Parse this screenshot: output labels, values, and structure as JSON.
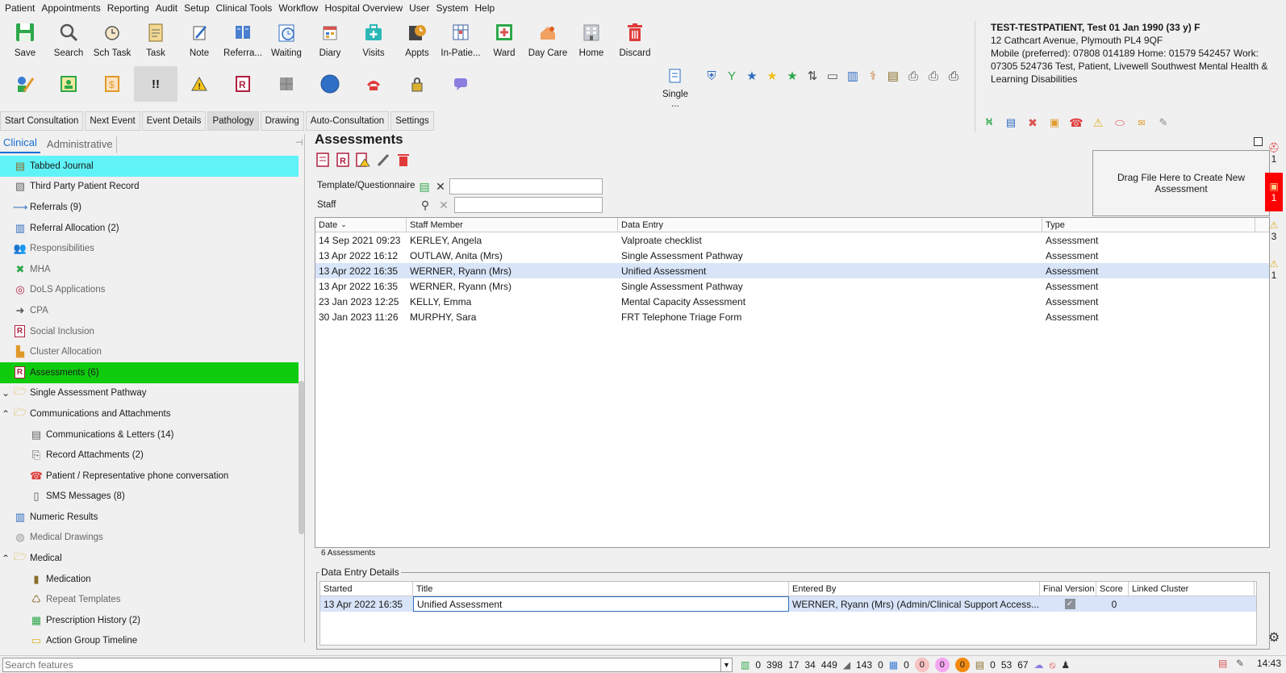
{
  "menu": [
    "Patient",
    "Appointments",
    "Reporting",
    "Audit",
    "Setup",
    "Clinical Tools",
    "Workflow",
    "Hospital Overview",
    "User",
    "System",
    "Help"
  ],
  "toolbar": [
    {
      "label": "Save",
      "icon": "save-icon"
    },
    {
      "label": "Search",
      "icon": "search-icon"
    },
    {
      "label": "Sch Task",
      "icon": "scheduled-task-icon"
    },
    {
      "label": "Task",
      "icon": "task-icon"
    },
    {
      "label": "Note",
      "icon": "note-icon"
    },
    {
      "label": "Referra...",
      "icon": "referral-icon"
    },
    {
      "label": "Waiting",
      "icon": "waiting-icon"
    },
    {
      "label": "Diary",
      "icon": "diary-icon"
    },
    {
      "label": "Visits",
      "icon": "visits-icon"
    },
    {
      "label": "Appts",
      "icon": "appointments-icon"
    },
    {
      "label": "In-Patie...",
      "icon": "inpatient-icon"
    },
    {
      "label": "Ward",
      "icon": "ward-icon"
    },
    {
      "label": "Day Care",
      "icon": "day-care-icon"
    },
    {
      "label": "Home",
      "icon": "home-icon"
    },
    {
      "label": "Discard",
      "icon": "discard-icon"
    }
  ],
  "single_label": "Single ...",
  "patient": {
    "name": "TEST-TESTPATIENT, Test 01 Jan 1990 (33 y) F",
    "address": "12 Cathcart Avenue, Plymouth PL4 9QF",
    "contact": "Mobile (preferred): 07808 014189 Home: 01579 542457 Work: 07305 524736   Test, Patient, Livewell Southwest Mental Health & Learning Disabilities"
  },
  "consult_buttons": [
    "Start Consultation",
    "Next Event",
    "Event Details",
    "Pathology",
    "Drawing",
    "Auto-Consultation",
    "Settings"
  ],
  "left_tabs": [
    "Clinical",
    "Administrative"
  ],
  "tree": [
    {
      "label": "Tabbed Journal",
      "indent": 0,
      "icon": "journal-icon",
      "style": "sel-cyan"
    },
    {
      "label": "Third Party Patient Record",
      "indent": 0,
      "icon": "third-party-record-icon"
    },
    {
      "label": "Referrals (9)",
      "indent": 0,
      "icon": "arrow-right-icon"
    },
    {
      "label": "Referral Allocation (2)",
      "indent": 0,
      "icon": "referral-allocation-icon"
    },
    {
      "label": "Responsibilities",
      "indent": 0,
      "icon": "people-icon",
      "style": "grey"
    },
    {
      "label": "MHA",
      "indent": 0,
      "icon": "cross-icon",
      "style": "grey"
    },
    {
      "label": "DoLS Applications",
      "indent": 0,
      "icon": "dols-icon",
      "style": "grey"
    },
    {
      "label": "CPA",
      "indent": 0,
      "icon": "arrow-right-bold-icon",
      "style": "grey"
    },
    {
      "label": "Social Inclusion",
      "indent": 0,
      "icon": "r-form-icon",
      "style": "grey"
    },
    {
      "label": "Cluster Allocation",
      "indent": 0,
      "icon": "cluster-icon",
      "style": "grey"
    },
    {
      "label": "Assessments (6)",
      "indent": 0,
      "icon": "r-form-icon",
      "style": "sel-green"
    },
    {
      "label": "Single Assessment Pathway",
      "indent": 0,
      "icon": "folder-icon",
      "toggle": "⌄"
    },
    {
      "label": "Communications and Attachments",
      "indent": 0,
      "icon": "folder-icon",
      "toggle": "^"
    },
    {
      "label": "Communications & Letters (14)",
      "indent": 1,
      "icon": "letter-icon"
    },
    {
      "label": "Record Attachments (2)",
      "indent": 1,
      "icon": "paperclip-icon"
    },
    {
      "label": "Patient / Representative phone conversation",
      "indent": 1,
      "icon": "phone-icon"
    },
    {
      "label": "SMS Messages (8)",
      "indent": 1,
      "icon": "sms-icon"
    },
    {
      "label": "Numeric Results",
      "indent": 0,
      "icon": "chart-icon"
    },
    {
      "label": "Medical Drawings",
      "indent": 0,
      "icon": "drawing-icon",
      "style": "grey"
    },
    {
      "label": "Medical",
      "indent": 0,
      "icon": "folder-icon",
      "toggle": "^"
    },
    {
      "label": "Medication",
      "indent": 1,
      "icon": "medication-icon"
    },
    {
      "label": "Repeat Templates",
      "indent": 1,
      "icon": "repeat-templates-icon",
      "style": "grey"
    },
    {
      "label": "Prescription History (2)",
      "indent": 1,
      "icon": "prescription-icon"
    },
    {
      "label": "Action Group Timeline",
      "indent": 1,
      "icon": "timeline-icon"
    }
  ],
  "main": {
    "title": "Assessments",
    "template_label": "Template/Questionnaire",
    "template_value": "",
    "staff_label": "Staff",
    "staff_value": "",
    "dropzone": "Drag File Here to Create New Assessment",
    "columns": [
      "Date",
      "Staff Member",
      "Data Entry",
      "Type"
    ],
    "rows": [
      {
        "date": "14 Sep 2021 09:23",
        "staff": "KERLEY, Angela",
        "entry": "Valproate checklist",
        "type": "Assessment"
      },
      {
        "date": "13 Apr 2022 16:12",
        "staff": "OUTLAW, Anita (Mrs)",
        "entry": "Single Assessment Pathway",
        "type": "Assessment"
      },
      {
        "date": "13 Apr 2022 16:35",
        "staff": "WERNER, Ryann (Mrs)",
        "entry": "Unified Assessment",
        "type": "Assessment"
      },
      {
        "date": "13 Apr 2022 16:35",
        "staff": "WERNER, Ryann (Mrs)",
        "entry": "Single Assessment Pathway",
        "type": "Assessment"
      },
      {
        "date": "23 Jan 2023 12:25",
        "staff": "KELLY, Emma",
        "entry": "Mental Capacity Assessment",
        "type": "Assessment"
      },
      {
        "date": "30 Jan 2023 11:26",
        "staff": "MURPHY, Sara",
        "entry": "FRT Telephone Triage Form",
        "type": "Assessment"
      }
    ],
    "selected_row": 2,
    "count": "6 Assessments"
  },
  "details": {
    "title": "Data Entry Details",
    "columns": [
      "Started",
      "Title",
      "Entered By",
      "Final Version",
      "Score",
      "Linked Cluster"
    ],
    "row": {
      "started": "13 Apr 2022 16:35",
      "title": "Unified Assessment",
      "entered_by": "WERNER, Ryann (Mrs) (Admin/Clinical Support Access...",
      "final_version": true,
      "score": "0",
      "linked_cluster": ""
    }
  },
  "right_strip": [
    "1",
    "1",
    "3",
    "1"
  ],
  "status": {
    "search_placeholder": "Search features",
    "stats": [
      "0",
      "398",
      "17",
      "34",
      "449",
      "143",
      "0",
      "0",
      "0",
      "0",
      "0",
      "0",
      "53",
      "67"
    ],
    "time": "14:43"
  },
  "colors": {
    "accent": "#1a6fd1",
    "selected_cyan": "#5ff3f7",
    "selected_green": "#0ecb0e",
    "row_selected": "#d8e4f8",
    "discard_red": "#e03a3a",
    "save_green": "#2ea84a"
  }
}
